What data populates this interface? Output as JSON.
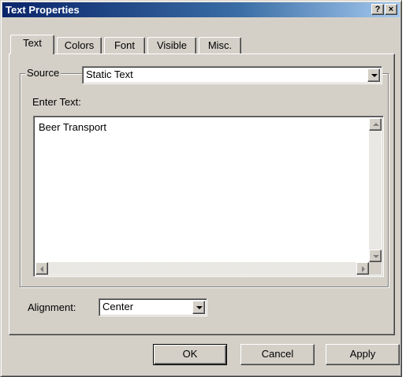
{
  "window": {
    "title": "Text Properties",
    "help_label": "?",
    "close_label": "×"
  },
  "tabs": [
    {
      "label": "Text",
      "active": true
    },
    {
      "label": "Colors",
      "active": false
    },
    {
      "label": "Font",
      "active": false
    },
    {
      "label": "Visible",
      "active": false
    },
    {
      "label": "Misc.",
      "active": false
    }
  ],
  "source": {
    "group_label": "Source",
    "selected": "Static Text"
  },
  "enter_text": {
    "label": "Enter Text:",
    "value": "Beer Transport"
  },
  "alignment": {
    "label": "Alignment:",
    "selected": "Center"
  },
  "buttons": {
    "ok": "OK",
    "cancel": "Cancel",
    "apply": "Apply"
  },
  "colors": {
    "face": "#d4d0c8",
    "title_start": "#0a246a",
    "title_end": "#a6caf0"
  },
  "icons": {
    "dropdown": "chevron-down-icon",
    "scroll_up": "arrow-up-icon",
    "scroll_down": "arrow-down-icon",
    "scroll_left": "arrow-left-icon",
    "scroll_right": "arrow-right-icon"
  }
}
